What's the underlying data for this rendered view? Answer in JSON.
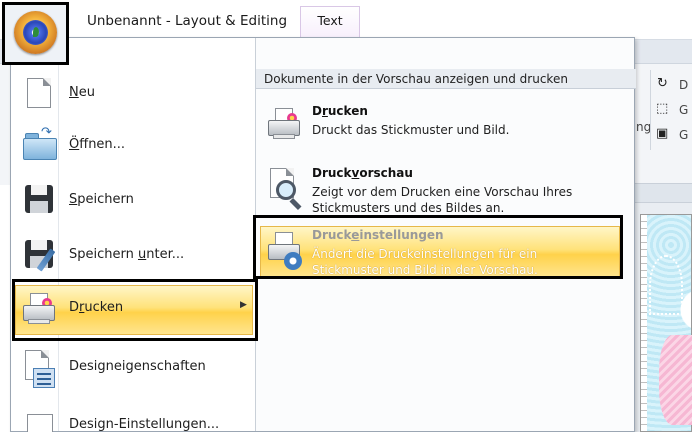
{
  "window": {
    "title": "Unbenannt - Layout & Editing",
    "active_tab": "Text"
  },
  "ribbon_fragments": {
    "d": "D",
    "g1": "G",
    "g2": "G",
    "ng": "ng"
  },
  "menu": {
    "items": [
      {
        "id": "neu",
        "pre": "",
        "accel": "N",
        "post": "eu",
        "icon": "new-document-icon"
      },
      {
        "id": "oeffnen",
        "pre": "",
        "accel": "Ö",
        "post": "ffnen...",
        "icon": "open-folder-icon"
      },
      {
        "id": "speichern",
        "pre": "",
        "accel": "S",
        "post": "peichern",
        "icon": "save-disk-icon"
      },
      {
        "id": "speichern-unter",
        "pre": "Speichern ",
        "accel": "u",
        "post": "nter...",
        "icon": "save-as-icon"
      },
      {
        "id": "drucken",
        "pre": "D",
        "accel": "r",
        "post": "ucken",
        "icon": "printer-icon",
        "selected": true,
        "arrow": "▶"
      },
      {
        "id": "designeigenschaften",
        "pre": "Designeigenschaften",
        "accel": "",
        "post": "",
        "icon": "design-properties-icon"
      },
      {
        "id": "design-einstellungen",
        "pre": "Design-Einstellungen...",
        "accel": "",
        "post": "",
        "icon": "design-settings-icon"
      }
    ]
  },
  "submenu": {
    "header": "Dokumente in der Vorschau anzeigen und drucken",
    "items": [
      {
        "id": "drucken",
        "title_pre": "D",
        "title_accel": "r",
        "title_post": "ucken",
        "desc_line1": "Druckt das Stickmuster und Bild.",
        "desc_line2": "",
        "icon": "printer-icon"
      },
      {
        "id": "druckvorschau",
        "title_pre": "Druck",
        "title_accel": "v",
        "title_post": "orschau",
        "desc_line1": "Zeigt vor dem Drucken eine Vorschau Ihres",
        "desc_line2": "Stickmusters und des Bildes an.",
        "icon": "print-preview-icon"
      },
      {
        "id": "druckeinstellungen",
        "title_pre": "Druck",
        "title_accel": "e",
        "title_post": "instellungen",
        "desc_line1": "Ändert die Druckeinstellungen für ein",
        "desc_line2": "Stickmuster und Bild in der Vorschau.",
        "icon": "print-settings-icon",
        "highlighted": true
      }
    ]
  },
  "colors": {
    "highlight_gradient_top": "#fff6c7",
    "highlight_gradient_mid": "#ffd24a",
    "callout_border": "#000000",
    "tab_accent": "#d9c7e6"
  }
}
